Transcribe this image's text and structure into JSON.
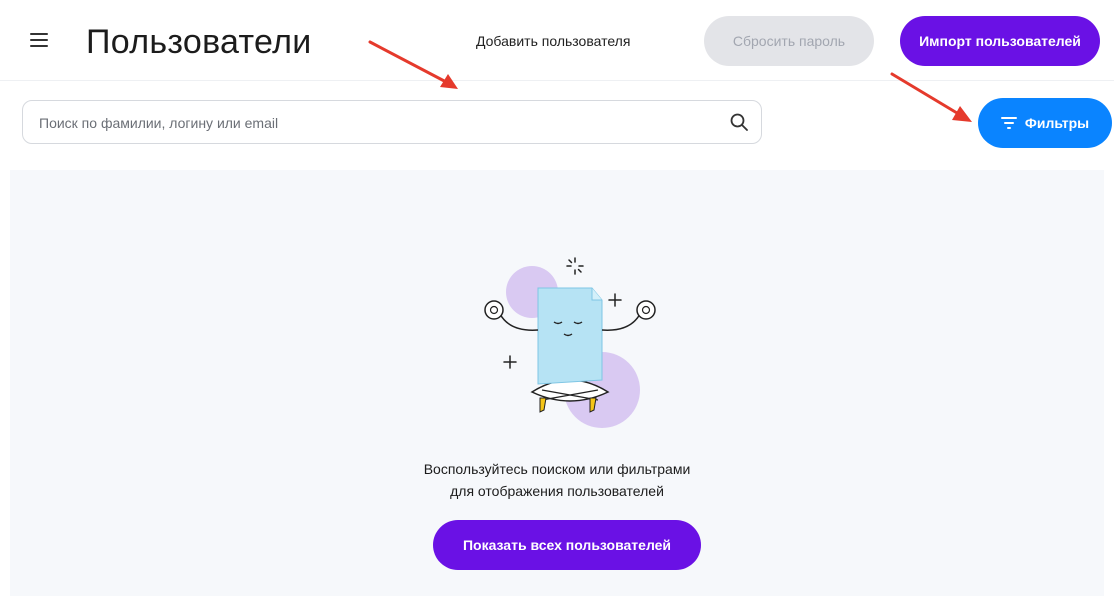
{
  "header": {
    "title": "Пользователи",
    "add_user_label": "Добавить пользователя",
    "reset_password_label": "Сбросить пароль",
    "import_users_label": "Импорт пользователей"
  },
  "search": {
    "placeholder": "Поиск по фамилии, логину или email",
    "value": ""
  },
  "filters": {
    "label": "Фильтры"
  },
  "empty_state": {
    "line1": "Воспользуйтесь поиском или фильтрами",
    "line2": "для отображения пользователей",
    "show_all_label": "Показать всех пользователей"
  },
  "icons": {
    "menu": "hamburger-menu-icon",
    "search": "search-icon",
    "filter": "filter-icon",
    "illustration": "meditating-document-illustration",
    "annotation": "red-arrow-icon"
  },
  "colors": {
    "primary": "#6a11e5",
    "filters": "#0a84ff",
    "disabled_bg": "#e3e4e8",
    "disabled_text": "#a2a6b0",
    "panel_bg": "#f6f8fb",
    "annotation_arrow": "#e53a2c"
  }
}
